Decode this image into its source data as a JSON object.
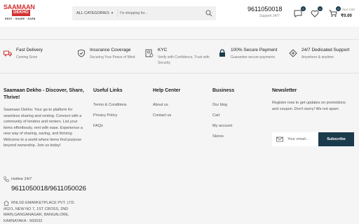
{
  "brand": {
    "name_top": "SAAMAAN",
    "name_box": "DEKHO",
    "tagline": "RENT · SHARE · EARN"
  },
  "search": {
    "category_label": "ALL CATEGORIES",
    "placeholder": "I'm shopping for..."
  },
  "contact": {
    "phone": "9611050018",
    "support": "Support 24/7"
  },
  "header_icons": [
    {
      "icon": "chat-icon",
      "badge": "0"
    },
    {
      "icon": "heart-icon",
      "badge": "0"
    }
  ],
  "cart": {
    "badge": "0",
    "label": "Your Cart",
    "total": "₹0.00"
  },
  "features": [
    {
      "icon": "truck-icon",
      "title": "Fast Delivery",
      "subtitle": "Coming Soon"
    },
    {
      "icon": "shield-icon",
      "title": "Insurance Coverage",
      "subtitle": "Securing Your Peace of Mind"
    },
    {
      "icon": "kyc-icon",
      "title": "KYC",
      "subtitle": "Verify with Confidence, Trust with Security"
    },
    {
      "icon": "lock-icon",
      "title": "100% Secure Payment",
      "subtitle": "Guarantee secure payments"
    },
    {
      "icon": "support-icon",
      "title": "24/7 Dedicated Support",
      "subtitle": "Anywhere & anytime"
    }
  ],
  "about": {
    "title": "Saamaan Dekho - Discover, Share, Thrive!",
    "text": "Saamaan Dekho: Your go-to platform for seamless sharing and renting. Connect with a community of lenders and renters. List your items effortlessly, rent with ease. Experience a new way of sharing, saving, and thriving. Welcome to a world where items find purpose beyond ownership. Join us today!"
  },
  "useful_links": {
    "title": "Useful Links",
    "items": [
      "Terms & Conditions",
      "Privacy Policy",
      "FAQs"
    ]
  },
  "help_center": {
    "title": "Help Center",
    "items": [
      "About us",
      "Contact us"
    ]
  },
  "business": {
    "title": "Business",
    "items": [
      "Our blog",
      "Cart",
      "My account",
      "Stores"
    ]
  },
  "newsletter": {
    "title": "Newsletter",
    "text": "Register now to get updates on promotions and coupon. Don't worry! We not spam",
    "placeholder": "Your email...",
    "button": "Subscribe"
  },
  "hotline": {
    "label": "Hotline 24/7",
    "numbers": "9611050018/9611050026"
  },
  "address": {
    "text": "RNLSD EMARKETPLACE PVT. LTD. #62/1, NEW NO 7, 1ST CROSS, 2ND MAIN,GANGANAGAR, BANGALORE, KARNATAKA - 560032"
  },
  "colors": {
    "brand_red": "#d32f2f",
    "accent_navy": "#1b3a4b",
    "background": "#f5f5f5"
  }
}
